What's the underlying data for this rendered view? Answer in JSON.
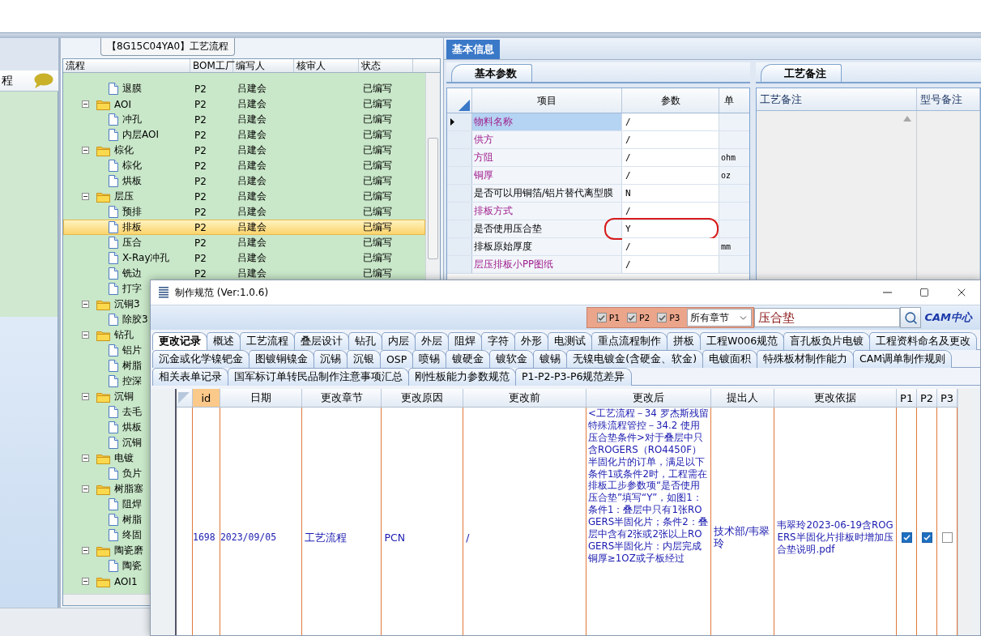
{
  "sidebar": {
    "label": "程"
  },
  "tree_panel": {
    "title": "【8G15C04YA0】工艺流程",
    "columns": [
      "流程",
      "BOM工厂",
      "编写人",
      "核审人",
      "状态"
    ],
    "nodes": [
      {
        "kind": "file",
        "label": "退膜",
        "bom": "P2",
        "author": "吕建会",
        "status": "已编写",
        "selected": false
      },
      {
        "kind": "folder",
        "label": "AOI",
        "expanded": true,
        "bom": "P2",
        "author": "吕建会",
        "status": "已编写",
        "selected": false,
        "children": [
          {
            "kind": "file",
            "label": "冲孔",
            "bom": "P2",
            "author": "吕建会",
            "status": "已编写",
            "selected": false
          },
          {
            "kind": "file",
            "label": "内层AOI",
            "bom": "P2",
            "author": "吕建会",
            "status": "已编写",
            "selected": false
          }
        ]
      },
      {
        "kind": "folder",
        "label": "棕化",
        "expanded": true,
        "bom": "P2",
        "author": "吕建会",
        "status": "已编写",
        "selected": false,
        "children": [
          {
            "kind": "file",
            "label": "棕化",
            "bom": "P2",
            "author": "吕建会",
            "status": "已编写",
            "selected": false
          },
          {
            "kind": "file",
            "label": "烘板",
            "bom": "P2",
            "author": "吕建会",
            "status": "已编写",
            "selected": false
          }
        ]
      },
      {
        "kind": "folder",
        "label": "层压",
        "expanded": true,
        "bom": "P2",
        "author": "吕建会",
        "status": "已编写",
        "selected": false,
        "children": [
          {
            "kind": "file",
            "label": "预排",
            "bom": "P2",
            "author": "吕建会",
            "status": "已编写",
            "selected": false
          },
          {
            "kind": "file",
            "label": "排板",
            "bom": "P2",
            "author": "吕建会",
            "status": "已编写",
            "selected": true
          },
          {
            "kind": "file",
            "label": "压合",
            "bom": "P2",
            "author": "吕建会",
            "status": "已编写",
            "selected": false
          },
          {
            "kind": "file",
            "label": "X-Ray冲孔",
            "bom": "P2",
            "author": "吕建会",
            "status": "已编写",
            "selected": false
          },
          {
            "kind": "file",
            "label": "铣边",
            "bom": "P2",
            "author": "吕建会",
            "status": "已编写",
            "selected": false
          },
          {
            "kind": "file",
            "label": "打字",
            "selected": false
          }
        ]
      },
      {
        "kind": "folder",
        "label": "沉铜3",
        "expanded": true,
        "selected": false,
        "children": [
          {
            "kind": "file",
            "label": "除胶3",
            "selected": false
          }
        ]
      },
      {
        "kind": "folder",
        "label": "钻孔",
        "expanded": true,
        "selected": false,
        "children": [
          {
            "kind": "file",
            "label": "铝片",
            "selected": false
          },
          {
            "kind": "file",
            "label": "树脂",
            "selected": false
          },
          {
            "kind": "file",
            "label": "控深",
            "selected": false
          }
        ]
      },
      {
        "kind": "folder",
        "label": "沉铜",
        "expanded": true,
        "selected": false,
        "children": [
          {
            "kind": "file",
            "label": "去毛",
            "selected": false
          },
          {
            "kind": "file",
            "label": "烘板",
            "selected": false
          },
          {
            "kind": "file",
            "label": "沉铜",
            "selected": false
          }
        ]
      },
      {
        "kind": "folder",
        "label": "电镀",
        "expanded": true,
        "selected": false,
        "children": [
          {
            "kind": "file",
            "label": "负片",
            "selected": false
          }
        ]
      },
      {
        "kind": "folder",
        "label": "树脂塞",
        "expanded": true,
        "selected": false,
        "children": [
          {
            "kind": "file",
            "label": "阻焊",
            "selected": false
          },
          {
            "kind": "file",
            "label": "树脂",
            "selected": false
          },
          {
            "kind": "file",
            "label": "终固",
            "selected": false
          }
        ]
      },
      {
        "kind": "folder",
        "label": "陶瓷磨",
        "expanded": true,
        "selected": false,
        "children": [
          {
            "kind": "file",
            "label": "陶瓷",
            "selected": false
          }
        ]
      },
      {
        "kind": "folder",
        "label": "AOI1",
        "expanded": true,
        "selected": false
      }
    ]
  },
  "info_tab": {
    "label": "基本信息",
    "selected": true
  },
  "params_panel": {
    "tab": {
      "label": "基本参数",
      "selected": true
    },
    "columns": [
      "项目",
      "参数",
      "单"
    ],
    "rows": [
      {
        "item": "物料名称",
        "value": "/",
        "emphasized": true,
        "selected": true,
        "circled": false
      },
      {
        "item": "供方",
        "value": "/",
        "emphasized": true,
        "selected": false,
        "circled": false
      },
      {
        "item": "方阻",
        "value": "/",
        "unit": "ohm",
        "emphasized": true,
        "selected": false,
        "circled": false
      },
      {
        "item": "铜厚",
        "value": "/",
        "unit": "oz",
        "emphasized": true,
        "selected": false,
        "circled": false
      },
      {
        "item": "是否可以用铜箔/铝片替代离型膜",
        "value": "N",
        "emphasized": false,
        "selected": false,
        "circled": false
      },
      {
        "item": "排板方式",
        "value": "/",
        "emphasized": true,
        "selected": false,
        "circled": false
      },
      {
        "item": "是否使用压合垫",
        "value": "Y",
        "emphasized": false,
        "selected": false,
        "circled": true
      },
      {
        "item": "排板原始厚度",
        "value": "/",
        "unit": "mm",
        "emphasized": false,
        "selected": false,
        "circled": false
      },
      {
        "item": "层压排板小PP图纸",
        "value": "/",
        "emphasized": true,
        "selected": false,
        "circled": false
      }
    ]
  },
  "notes_panel": {
    "tab": {
      "label": "工艺备注",
      "selected": true
    },
    "columns": [
      "工艺备注",
      "型号备注"
    ]
  },
  "dialog": {
    "title": "制作规范 (Ver:1.0.6)",
    "filters": [
      {
        "label": "P1",
        "checked": true
      },
      {
        "label": "P2",
        "checked": true
      },
      {
        "label": "P3",
        "checked": true
      }
    ],
    "chapter_select": "所有章节",
    "search": {
      "value": "压合垫"
    },
    "logo": "CAM中心",
    "tab_rows": [
      {
        "tabs": [
          {
            "label": "更改记录",
            "selected": true
          },
          {
            "label": "概述",
            "selected": false
          },
          {
            "label": "工艺流程",
            "selected": false
          },
          {
            "label": "叠层设计",
            "selected": false
          },
          {
            "label": "钻孔",
            "selected": false
          },
          {
            "label": "内层",
            "selected": false
          },
          {
            "label": "外层",
            "selected": false
          },
          {
            "label": "阻焊",
            "selected": false
          },
          {
            "label": "字符",
            "selected": false
          },
          {
            "label": "外形",
            "selected": false
          },
          {
            "label": "电测试",
            "selected": false
          },
          {
            "label": "重点流程制作",
            "selected": false
          },
          {
            "label": "拼板",
            "selected": false
          },
          {
            "label": "工程W006规范",
            "selected": false
          },
          {
            "label": "盲孔板负片电镀",
            "selected": false
          },
          {
            "label": "工程资料命名及更改",
            "selected": false
          }
        ]
      },
      {
        "tabs": [
          {
            "label": "沉金或化学镍钯金",
            "selected": false
          },
          {
            "label": "图镀铜镍金",
            "selected": false
          },
          {
            "label": "沉锡",
            "selected": false
          },
          {
            "label": "沉银",
            "selected": false
          },
          {
            "label": "OSP",
            "selected": false
          },
          {
            "label": "喷锡",
            "selected": false
          },
          {
            "label": "镀硬金",
            "selected": false
          },
          {
            "label": "镀软金",
            "selected": false
          },
          {
            "label": "镀锡",
            "selected": false
          },
          {
            "label": "无镍电镀金(含硬金、软金)",
            "selected": false
          },
          {
            "label": "电镀面积",
            "selected": false
          },
          {
            "label": "特殊板材制作能力",
            "selected": false
          },
          {
            "label": "CAM调单制作规则",
            "selected": false
          }
        ]
      },
      {
        "tabs": [
          {
            "label": "相关表单记录",
            "selected": false
          },
          {
            "label": "国军标订单转民品制作注意事项汇总",
            "selected": false
          },
          {
            "label": "刚性板能力参数规范",
            "selected": false
          },
          {
            "label": "P1-P2-P3-P6规范差异",
            "selected": false
          }
        ]
      }
    ],
    "table": {
      "columns": [
        {
          "label": "id",
          "selected": true
        },
        {
          "label": "日期",
          "selected": false
        },
        {
          "label": "更改章节",
          "selected": false
        },
        {
          "label": "更改原因",
          "selected": false
        },
        {
          "label": "更改前",
          "selected": false
        },
        {
          "label": "更改后",
          "selected": false
        },
        {
          "label": "提出人",
          "selected": false
        },
        {
          "label": "更改依据",
          "selected": false
        },
        {
          "label": "P1",
          "selected": false
        },
        {
          "label": "P2",
          "selected": false
        },
        {
          "label": "P3",
          "selected": false
        }
      ],
      "rows": [
        {
          "id": "1698",
          "date": "2023/09/05",
          "chapter": "工艺流程",
          "reason": "PCN",
          "before": "/",
          "after": "<工艺流程－34 罗杰斯残留特殊流程管控－34.2 使用压合垫条件>对于叠层中只含ROGERS（RO4450F）半固化片的订单，满足以下条件1或条件2时，工程需在排板工步参数项“是否使用压合垫”填写“Y”，如图1：条件1：叠层中只有1张ROGERS半固化片；条件2：叠层中含有2张或2张以上ROGERS半固化片：内层完成铜厚≥1OZ或子板经过",
          "proposer": "技术部/韦翠玲",
          "basis": "韦翠玲2023-06-19含ROGERS半固化片排板时增加压合垫说明.pdf",
          "p1": true,
          "p2": true,
          "p3": false
        }
      ]
    }
  }
}
